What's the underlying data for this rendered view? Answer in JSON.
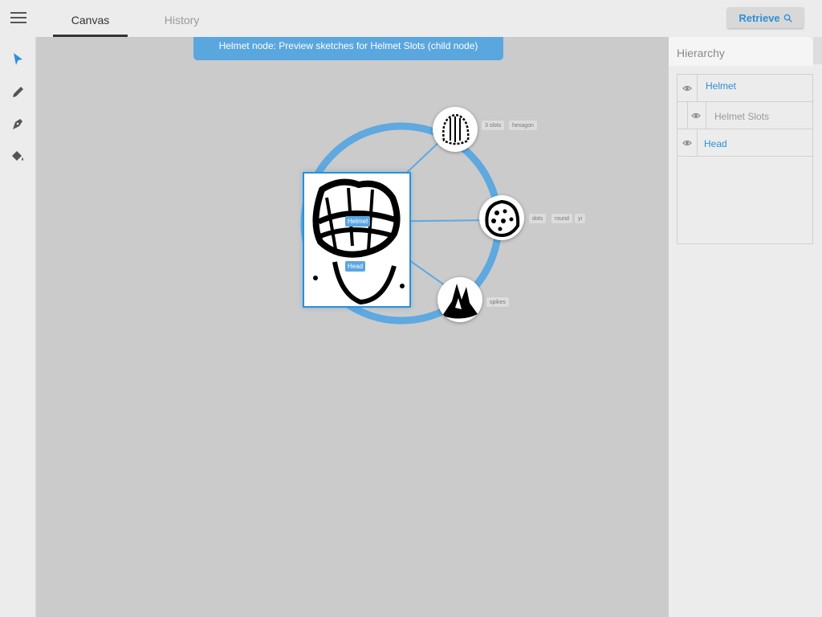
{
  "header": {
    "tabs": [
      {
        "label": "Canvas",
        "active": true
      },
      {
        "label": "History",
        "active": false
      }
    ],
    "retrieve_label": "Retrieve",
    "menu_icon": "hamburger-menu-icon"
  },
  "toolbar": {
    "tools": [
      {
        "name": "select",
        "icon": "cursor-arrow-icon",
        "active": true
      },
      {
        "name": "pencil",
        "icon": "pencil-icon",
        "active": false
      },
      {
        "name": "pen",
        "icon": "pen-nib-icon",
        "active": false
      },
      {
        "name": "fill",
        "icon": "paint-bucket-icon",
        "active": false
      }
    ]
  },
  "canvas": {
    "banner": "Helmet node: Preview sketches for Helmet Slots (child node)",
    "main_node": {
      "labels": [
        "Helmet",
        "Head"
      ]
    },
    "child_nodes": [
      {
        "id": "slots",
        "tags": [
          "3 slots",
          "hexagon"
        ]
      },
      {
        "id": "dots",
        "tags": [
          "dots",
          "round",
          "yi"
        ]
      },
      {
        "id": "spikes",
        "tags": [
          "spikes"
        ]
      }
    ]
  },
  "hierarchy": {
    "title": "Hierarchy",
    "items": [
      {
        "label": "Helmet",
        "level": 0,
        "selected": true
      },
      {
        "label": "Helmet Slots",
        "level": 1,
        "selected": false
      },
      {
        "label": "Head",
        "level": 0,
        "selected": true
      }
    ]
  },
  "colors": {
    "accent": "#2d8fd8",
    "banner": "#5aa6df",
    "ring": "#5fa8e0",
    "canvas_bg": "#cbcbcb"
  }
}
